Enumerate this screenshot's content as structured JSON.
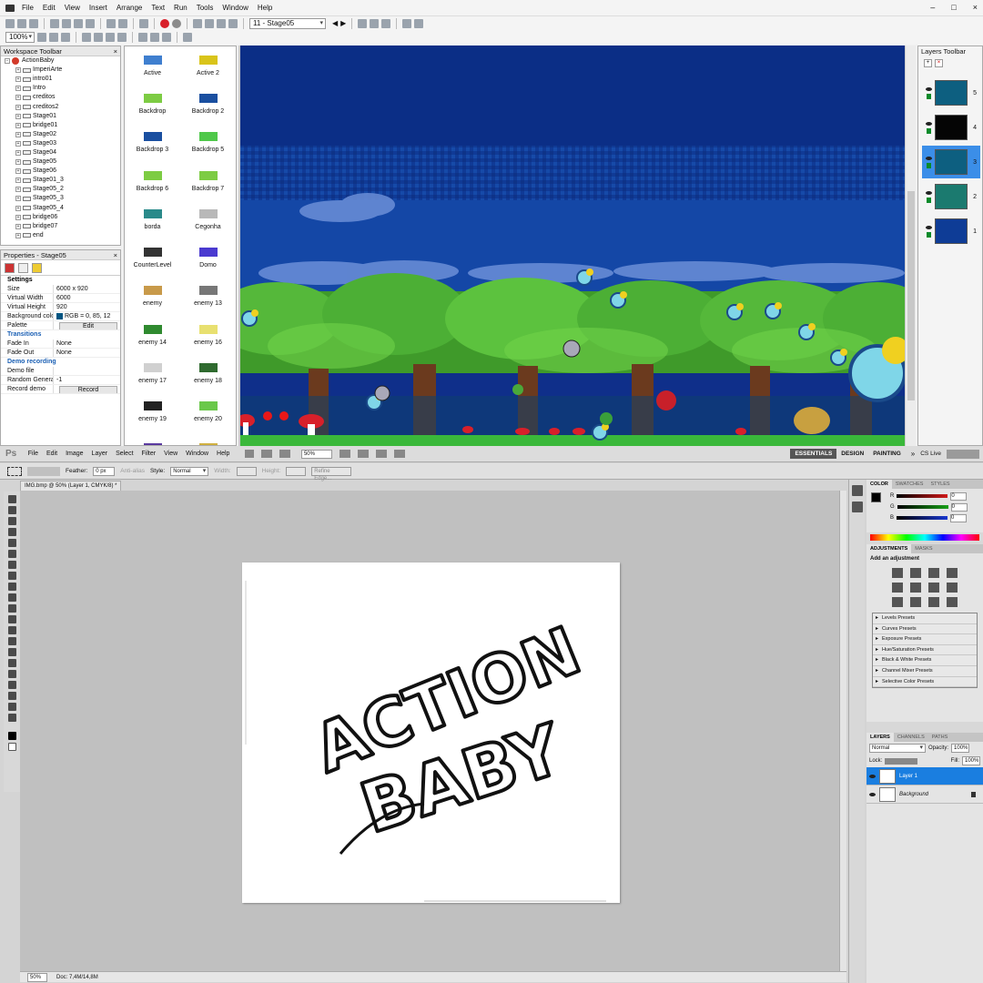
{
  "editor": {
    "menu": [
      "File",
      "Edit",
      "View",
      "Insert",
      "Arrange",
      "Text",
      "Run",
      "Tools",
      "Window",
      "Help"
    ],
    "window_controls": [
      "–",
      "□",
      "×"
    ],
    "frame_select": "11 - Stage05",
    "zoom": "100%",
    "workspace": {
      "title": "Workspace Toolbar",
      "root": "ActionBaby",
      "frames": [
        "ImperiArte",
        "intro01",
        "Intro",
        "creditos",
        "creditos2",
        "Stage01",
        "bridge01",
        "Stage02",
        "Stage03",
        "Stage04",
        "Stage05",
        "Stage06",
        "Stage01_3",
        "Stage05_2",
        "Stage05_3",
        "Stage05_4",
        "bridge06",
        "bridge07",
        "end"
      ]
    },
    "properties": {
      "title": "Properties - Stage05",
      "settings_header": "Settings",
      "rows": [
        {
          "k": "Size",
          "v": "6000 x 920"
        },
        {
          "k": "Virtual Width",
          "v": "6000"
        },
        {
          "k": "Virtual Height",
          "v": "920"
        },
        {
          "k": "Background color",
          "v": "RGB = 0, 85, 12"
        }
      ],
      "palette_label": "Palette",
      "palette_btn": "Edit",
      "transitions_header": "Transitions",
      "fade_in_label": "Fade In",
      "fade_in_value": "None",
      "fade_out_label": "Fade Out",
      "fade_out_value": "None",
      "demo_header": "Demo recording",
      "demo_file_label": "Demo file",
      "random_label": "Random Generat",
      "random_value": "-1",
      "record_label": "Record demo",
      "record_btn": "Record"
    },
    "objects": [
      {
        "label": "Active",
        "color": "#3f7fcf"
      },
      {
        "label": "Active 2",
        "color": "#d9c41a"
      },
      {
        "label": "Backdrop",
        "color": "#7dcc43"
      },
      {
        "label": "Backdrop 2",
        "color": "#1a4fa0"
      },
      {
        "label": "Backdrop 3",
        "color": "#1a4fa0"
      },
      {
        "label": "Backdrop 5",
        "color": "#4fc84a"
      },
      {
        "label": "Backdrop 6",
        "color": "#7dcc43"
      },
      {
        "label": "Backdrop 7",
        "color": "#7dcc43"
      },
      {
        "label": "borda",
        "color": "#2a8a8a"
      },
      {
        "label": "Cegonha",
        "color": "#b8b8b8"
      },
      {
        "label": "CounterLevel",
        "color": "#333333"
      },
      {
        "label": "Domo",
        "color": "#4a3ad0"
      },
      {
        "label": "enemy",
        "color": "#c89a4a"
      },
      {
        "label": "enemy 13",
        "color": "#777777"
      },
      {
        "label": "enemy 14",
        "color": "#2f8a2f"
      },
      {
        "label": "enemy 16",
        "color": "#e8e070"
      },
      {
        "label": "enemy 17",
        "color": "#d0d0d0"
      },
      {
        "label": "enemy 18",
        "color": "#2f6a2f"
      },
      {
        "label": "enemy 19",
        "color": "#222222"
      },
      {
        "label": "enemy 20",
        "color": "#6ac84a"
      },
      {
        "label": "",
        "color": "#5a3aa0"
      },
      {
        "label": "",
        "color": "#d0b040"
      }
    ],
    "layers_panel": {
      "title": "Layers Toolbar",
      "layers": [
        {
          "num": "5",
          "thumb": "#0d5f80",
          "selected": false
        },
        {
          "num": "4",
          "thumb": "#050505",
          "selected": false
        },
        {
          "num": "3",
          "thumb": "#0d5f80",
          "selected": true
        },
        {
          "num": "2",
          "thumb": "#1b7a6f",
          "selected": false
        },
        {
          "num": "1",
          "thumb": "#0e3c96",
          "selected": false
        }
      ]
    }
  },
  "photoshop": {
    "logo": "Ps",
    "menu": [
      "File",
      "Edit",
      "Image",
      "Layer",
      "Select",
      "Filter",
      "View",
      "Window",
      "Help"
    ],
    "zoom_combo": "50%",
    "workspaces": [
      "ESSENTIALS",
      "DESIGN",
      "PAINTING"
    ],
    "cs_live": "CS Live",
    "options": {
      "feather_label": "Feather:",
      "feather_value": "0 px",
      "antialias": "Anti-alias",
      "style_label": "Style:",
      "style_value": "Normal",
      "width_label": "Width:",
      "height_label": "Height:",
      "refine": "Refine Edge..."
    },
    "doc_tab": "IMG.bmp @ 50% (Layer 1, CMYK/8) *",
    "status_zoom": "50%",
    "status_doc": "Doc: 7,4M/14,8M",
    "color_tabs": [
      "COLOR",
      "SWATCHES",
      "STYLES"
    ],
    "color_values": [
      {
        "ch": "R",
        "value": "0",
        "color": "#d01818"
      },
      {
        "ch": "G",
        "value": "0",
        "color": "#18a018"
      },
      {
        "ch": "B",
        "value": "0",
        "color": "#1838d0"
      }
    ],
    "adj_tabs": [
      "ADJUSTMENTS",
      "MASKS"
    ],
    "adj_title": "Add an adjustment",
    "presets": [
      "Levels Presets",
      "Curves Presets",
      "Exposure Presets",
      "Hue/Saturation Presets",
      "Black & White Presets",
      "Channel Mixer Presets",
      "Selective Color Presets"
    ],
    "layers_tabs": [
      "LAYERS",
      "CHANNELS",
      "PATHS"
    ],
    "blend_mode": "Normal",
    "opacity_label": "Opacity:",
    "opacity_value": "100%",
    "lock_label": "Lock:",
    "fill_label": "Fill:",
    "fill_value": "100%",
    "layers": [
      "Layer 1",
      "Background"
    ]
  },
  "artwork": {
    "word1": "ACTION",
    "word2": "BABY"
  }
}
